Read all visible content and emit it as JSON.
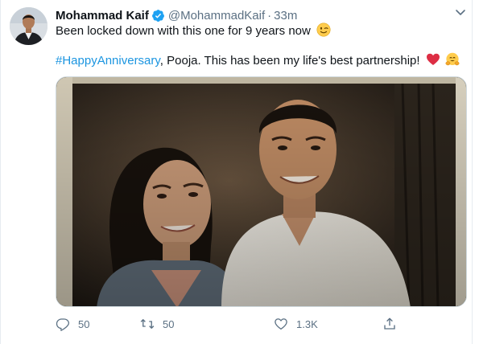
{
  "tweet": {
    "author_name": "Mohammad Kaif",
    "handle": "@MohammadKaif",
    "separator": "·",
    "time": "33m",
    "line1_text": "Been locked down with this one for 9 years now",
    "hashtag": "#HappyAnniversary",
    "line2_text": ", Pooja. This has been my life's best partnership!",
    "icons": {
      "verified": "verified-badge-icon",
      "more": "chevron-down-icon",
      "wink_emoji": "winking-face-emoji",
      "heart_emoji": "red-heart-emoji",
      "hug_emoji": "hugging-face-emoji"
    }
  },
  "actions": {
    "reply_count": "50",
    "retweet_count": "50",
    "like_count": "1.3K"
  },
  "colors": {
    "link": "#1b95e0",
    "muted": "#5b7083",
    "verified": "#1da1f2",
    "heart": "#e0245e"
  }
}
